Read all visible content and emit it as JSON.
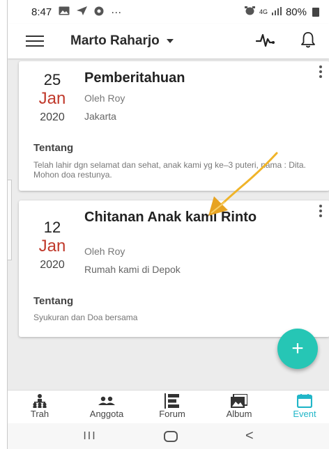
{
  "status_bar": {
    "time": "8:47",
    "icons_left": [
      "image-icon",
      "send-icon",
      "app-icon",
      "more-icon"
    ],
    "overflow": "···",
    "network": "4G",
    "battery": "80%"
  },
  "app_bar": {
    "user_name": "Marto Raharjo"
  },
  "events": [
    {
      "day": "25",
      "month": "Jan",
      "year": "2020",
      "title": "Pemberitahuan",
      "organizer": "Oleh Roy",
      "location": "Jakarta",
      "about_label": "Tentang",
      "description": "Telah lahir dgn selamat dan sehat, anak kami yg ke–3 puteri, nama : Dita. Mohon doa restunya."
    },
    {
      "day": "12",
      "month": "Jan",
      "year": "2020",
      "title": "Chitanan Anak kami Rinto",
      "organizer": "Oleh Roy",
      "location": "Rumah kami di Depok",
      "about_label": "Tentang",
      "description": "Syukuran dan Doa bersama"
    }
  ],
  "fab": {
    "label": "+"
  },
  "bottom_nav": [
    {
      "label": "Trah",
      "icon": "family-tree-icon",
      "active": false
    },
    {
      "label": "Anggota",
      "icon": "members-icon",
      "active": false
    },
    {
      "label": "Forum",
      "icon": "forum-icon",
      "active": false
    },
    {
      "label": "Album",
      "icon": "album-icon",
      "active": false
    },
    {
      "label": "Event",
      "icon": "calendar-icon",
      "active": true
    }
  ],
  "system_nav": {
    "recents": "III",
    "back": "<"
  },
  "colors": {
    "accent": "#21b6c8",
    "fab": "#26c6b5",
    "month": "#c0392b",
    "annotation_arrow": "#f0b429"
  }
}
